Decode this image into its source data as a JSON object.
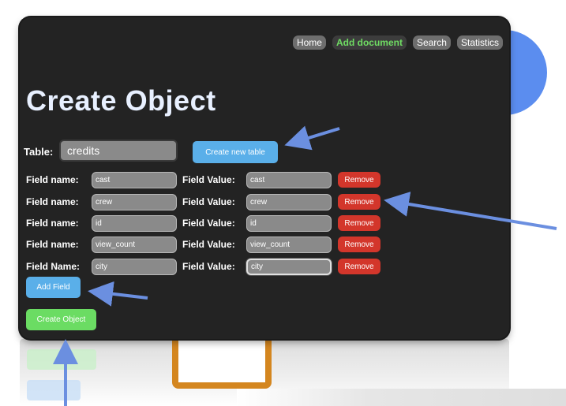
{
  "nav": {
    "items": [
      {
        "label": "Home",
        "active": false
      },
      {
        "label": "Add document",
        "active": true
      },
      {
        "label": "Search",
        "active": false
      },
      {
        "label": "Statistics",
        "active": false
      }
    ]
  },
  "page_title": "Create Object",
  "table": {
    "label": "Table:",
    "value": "credits",
    "create_button": "Create new table"
  },
  "fields": [
    {
      "name_label": "Field name:",
      "name": "cast",
      "value_label": "Field Value:",
      "value": "cast",
      "remove": "Remove"
    },
    {
      "name_label": "Field name:",
      "name": "crew",
      "value_label": "Field Value:",
      "value": "crew",
      "remove": "Remove"
    },
    {
      "name_label": "Field name:",
      "name": "id",
      "value_label": "Field Value:",
      "value": "id",
      "remove": "Remove"
    },
    {
      "name_label": "Field name:",
      "name": "view_count",
      "value_label": "Field Value:",
      "value": "view_count",
      "remove": "Remove"
    },
    {
      "name_label": "Field Name:",
      "name": "city",
      "value_label": "Field Value:",
      "value": "city",
      "remove": "Remove"
    }
  ],
  "add_field_button": "Add Field",
  "create_object_button": "Create Object",
  "colors": {
    "window_bg": "#232323",
    "accent_blue": "#5aafe9",
    "accent_green": "#6bdc63",
    "remove_red": "#d3362b",
    "arrow_blue": "#6b8fe0",
    "deco_circle": "#5b8def",
    "deco_square": "#d4861f"
  }
}
